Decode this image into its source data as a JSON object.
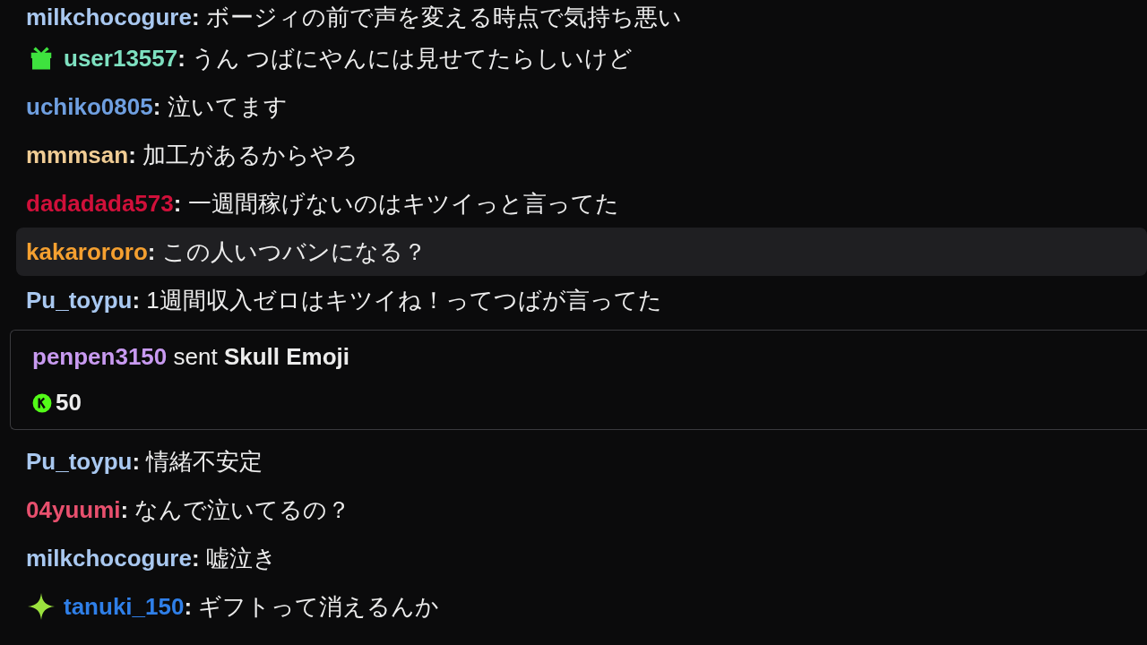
{
  "messages": [
    {
      "kind": "chat",
      "user": "milkchocogure",
      "color": "#a9c8f0",
      "sep": ":",
      "text": "ボージィの前で声を変える時点で気持ち悪い",
      "highlighted": false
    },
    {
      "kind": "chat",
      "badge": {
        "kind": "gift"
      },
      "user": "user13557",
      "color": "#7ee0c0",
      "sep": ":",
      "text": "うん つばにやんには見せてたらしいけど",
      "highlighted": false
    },
    {
      "kind": "chat",
      "user": "uchiko0805",
      "color": "#6f9fe0",
      "sep": ":",
      "text": "泣いてます",
      "highlighted": false
    },
    {
      "kind": "chat",
      "user": "mmmsan",
      "color": "#f0cc94",
      "sep": ":",
      "text": "加工があるからやろ",
      "highlighted": false
    },
    {
      "kind": "chat",
      "user": "dadadada573",
      "color": "#d0103a",
      "sep": ":",
      "text": "一週間稼げないのはキツイっと言ってた",
      "highlighted": false
    },
    {
      "kind": "chat",
      "user": "kakarororo",
      "color": "#f5a030",
      "sep": ":",
      "text": "この人いつバンになる？",
      "highlighted": true
    },
    {
      "kind": "chat",
      "user": "Pu_toypu",
      "color": "#a9c8f0",
      "sep": ":",
      "text": "1週間収入ゼロはキツイね！ってつばが言ってた",
      "highlighted": false
    },
    {
      "kind": "gift",
      "user": "penpen3150",
      "color": "#c89af0",
      "verb": "sent",
      "item": "Skull Emoji",
      "amount": "50"
    },
    {
      "kind": "chat",
      "user": "Pu_toypu",
      "color": "#a9c8f0",
      "sep": ":",
      "text": "情緒不安定",
      "highlighted": false
    },
    {
      "kind": "chat",
      "user": "04yuumi",
      "color": "#e8506e",
      "sep": ":",
      "text": "なんで泣いてるの？",
      "highlighted": false
    },
    {
      "kind": "chat",
      "user": "milkchocogure",
      "color": "#a9c8f0",
      "sep": ":",
      "text": "嘘泣き",
      "highlighted": false
    },
    {
      "kind": "chat",
      "badge": {
        "kind": "sparkle"
      },
      "user": "tanuki_150",
      "color": "#2f7fe8",
      "sep": ":",
      "text": "ギフトって消えるんか",
      "highlighted": false
    }
  ]
}
